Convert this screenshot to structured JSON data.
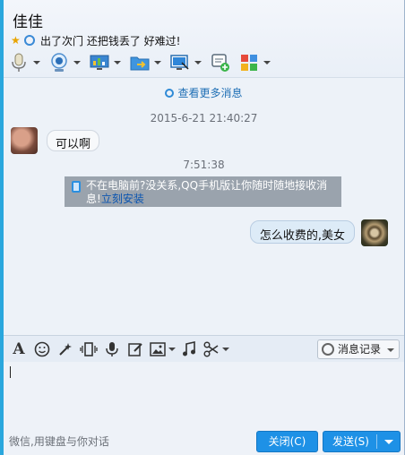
{
  "header": {
    "contact_name": "佳佳",
    "signature": "出了次门   还把钱丢了   好难过!",
    "toolbar": [
      {
        "name": "voice-call",
        "icon": "microphone-icon",
        "has_menu": true
      },
      {
        "name": "video-call",
        "icon": "webcam-icon",
        "has_menu": true
      },
      {
        "name": "remote-assist",
        "icon": "monitor-icon",
        "has_menu": true
      },
      {
        "name": "send-file",
        "icon": "folder-transfer-icon",
        "has_menu": true
      },
      {
        "name": "share-screen",
        "icon": "screen-share-icon",
        "has_menu": true
      },
      {
        "name": "create-group",
        "icon": "chat-add-icon",
        "has_menu": false
      },
      {
        "name": "apps",
        "icon": "apps-grid-icon",
        "has_menu": true
      }
    ]
  },
  "messages": {
    "more_link": "查看更多消息",
    "timestamp_1": "2015-6-21 21:40:27",
    "incoming_text": "可以啊",
    "timestamp_2": "7:51:38",
    "notice_text": "不在电脑前?没关系,QQ手机版让你随时随地接收消息!",
    "notice_link": "立刻安装",
    "outgoing_text": "怎么收费的,美女"
  },
  "input": {
    "history_label": "消息记录",
    "hint": "微信,用键盘与你对话"
  },
  "buttons": {
    "close_label": "关闭(C)",
    "send_label": "发送(S)"
  },
  "colors": {
    "accent": "#2aa7dd",
    "button_blue": "#1e91e6",
    "notice_gray": "#9aa3ad",
    "link_blue": "#1f6fb5"
  }
}
